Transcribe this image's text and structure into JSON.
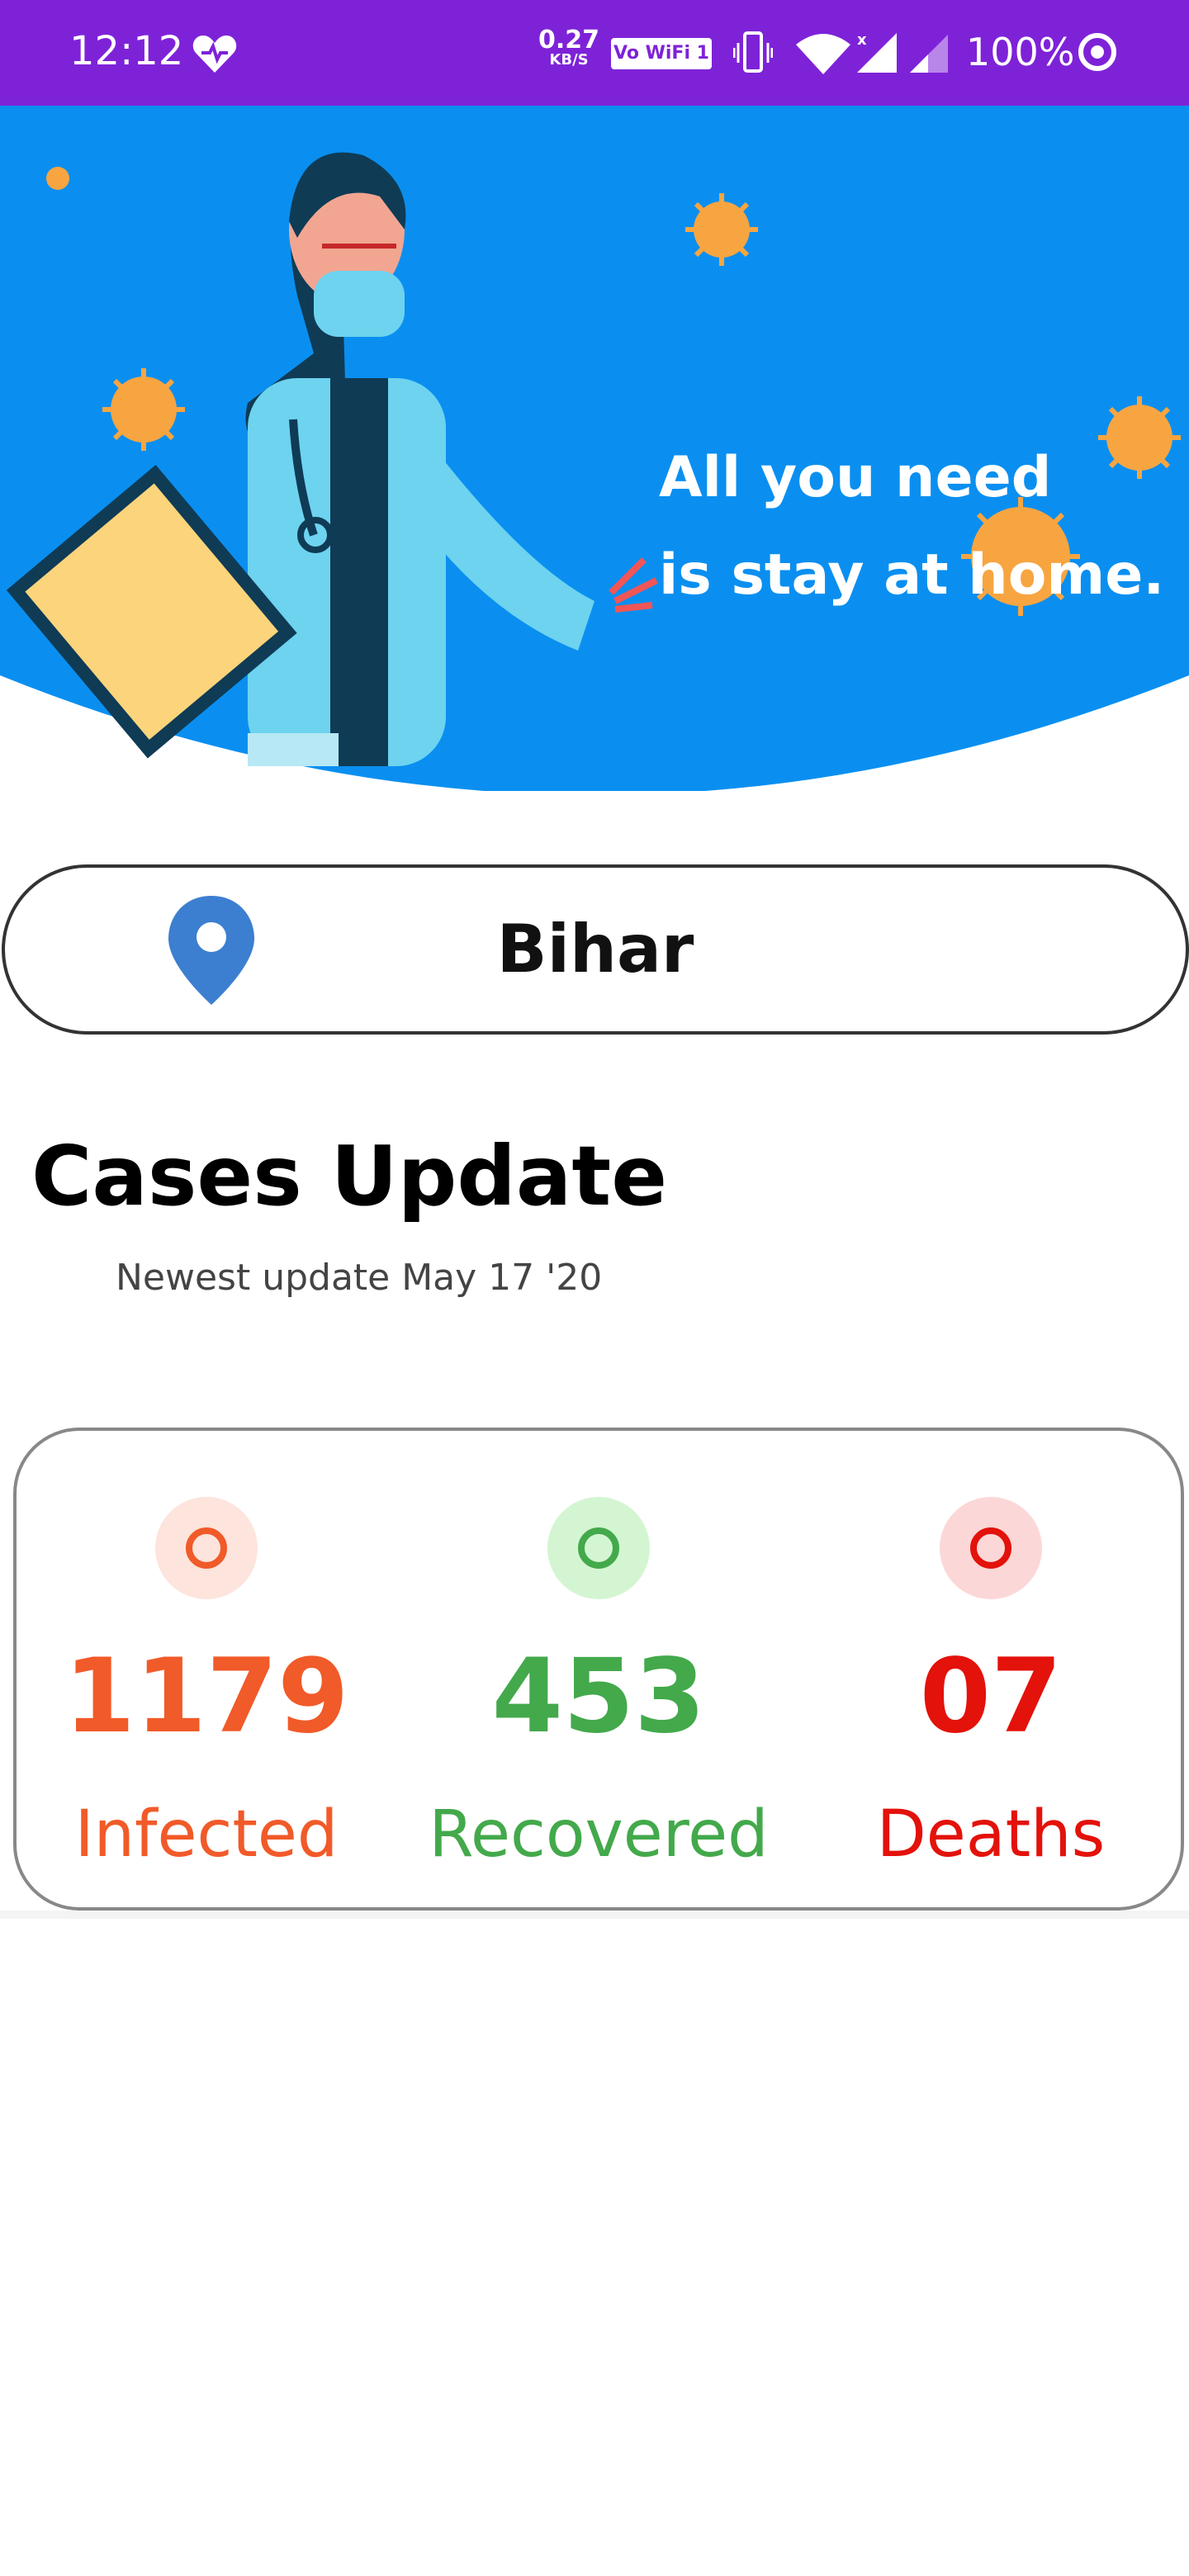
{
  "status_bar": {
    "time": "12:12",
    "net_speed_value": "0.27",
    "net_speed_unit": "KB/S",
    "vowifi": "Vo WiFi 1",
    "battery": "100%",
    "bg_color": "#7e22d8"
  },
  "banner": {
    "tagline_line1": "All you need",
    "tagline_line2": "is stay at home.",
    "bg_color": "#0a8ff0"
  },
  "location": {
    "name": "Bihar",
    "icon": "location-pin-icon"
  },
  "cases": {
    "title": "Cases Update",
    "subtitle": "Newest update May 17 '20"
  },
  "stats": [
    {
      "value": "1179",
      "label": "Infected",
      "color": "#f15a29",
      "dot_bg": "#fde4dc"
    },
    {
      "value": "453",
      "label": "Recovered",
      "color": "#43a94b",
      "dot_bg": "#d4f5d1"
    },
    {
      "value": "07",
      "label": "Deaths",
      "color": "#e3120b",
      "dot_bg": "#fcd7d7"
    }
  ]
}
